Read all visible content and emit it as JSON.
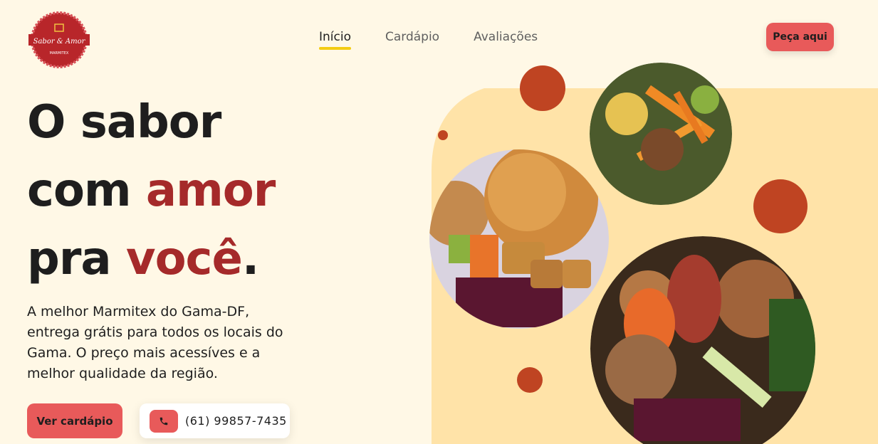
{
  "brand": {
    "logo_name": "Sabor & Amor",
    "logo_sub": "MARMITEX",
    "colors": {
      "primary": "#e85a5a",
      "accent": "#a52a2a",
      "background": "#fff8e6",
      "panel": "#ffe3a8",
      "underline": "#f4cc12"
    }
  },
  "nav": {
    "items": [
      {
        "label": "Início",
        "active": true
      },
      {
        "label": "Cardápio",
        "active": false
      },
      {
        "label": "Avaliações",
        "active": false
      }
    ],
    "cta_label": "Peça aqui"
  },
  "hero": {
    "line1": "O sabor",
    "line2_prefix": "com ",
    "line2_accent": "amor",
    "line3_prefix": "pra ",
    "line3_accent": "você",
    "line3_suffix": ".",
    "description": "A melhor Marmitex do Gama-DF, entrega grátis para todos os locais do Gama. O preço mais acessíves e a melhor qualidade da região.",
    "menu_button": "Ver cardápio",
    "phone_icon": "phone-icon",
    "phone": "(61) 99857-7435"
  },
  "images": {
    "plate_1": "food-plate-breaded",
    "plate_2": "food-plate-vegetables",
    "plate_3": "food-plate-meat"
  }
}
